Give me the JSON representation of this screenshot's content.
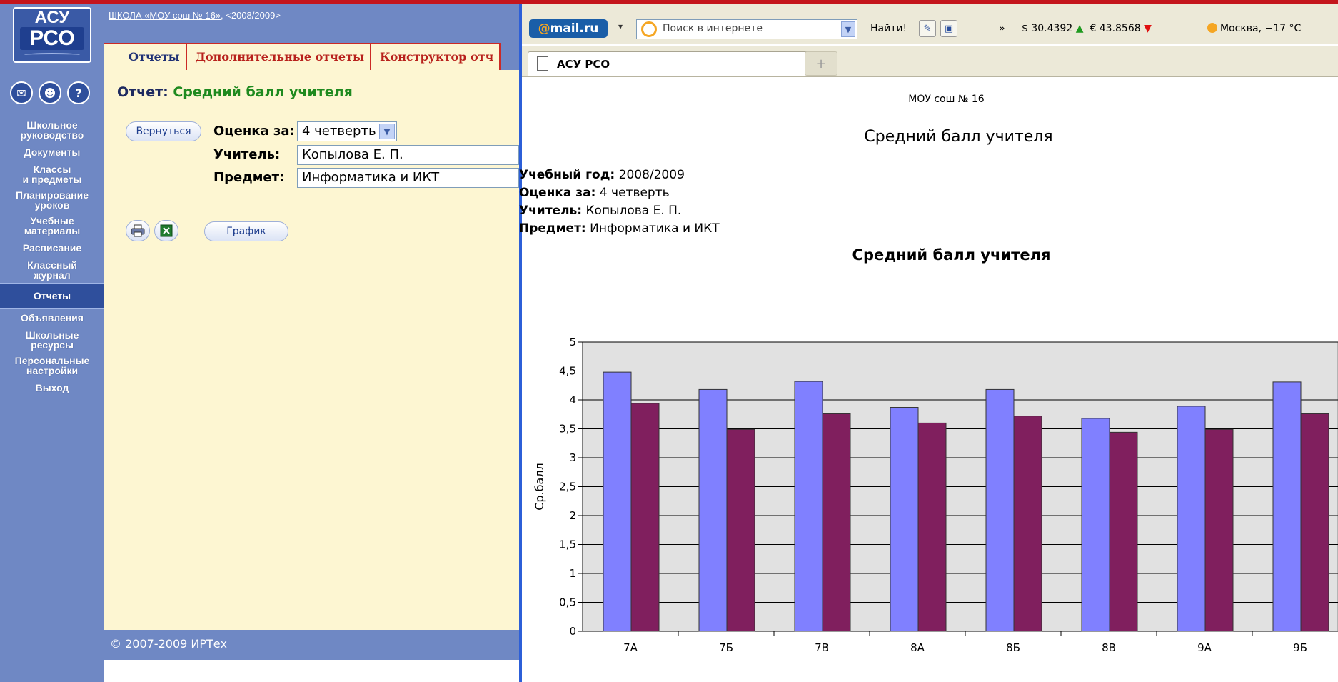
{
  "app": {
    "logo_top": "АСУ",
    "logo_bottom": "РСО",
    "header_school_link": "ШКОЛА «МОУ сош № 16»",
    "header_year": ", <2008/2009>",
    "nav": [
      {
        "label": "Школьное\nруководство"
      },
      {
        "label": "Документы"
      },
      {
        "label": "Классы\nи предметы"
      },
      {
        "label": "Планирование\nуроков"
      },
      {
        "label": "Учебные\nматериалы"
      },
      {
        "label": "Расписание"
      },
      {
        "label": "Классный\nжурнал"
      },
      {
        "label": "Отчеты"
      },
      {
        "label": "Объявления"
      },
      {
        "label": "Школьные\nресурсы"
      },
      {
        "label": "Персональные\nнастройки"
      },
      {
        "label": "Выход"
      }
    ],
    "tabs": [
      "Отчеты",
      "Дополнительные отчеты",
      "Конструктор отч"
    ],
    "report_label": "Отчет:",
    "report_name": "Средний балл учителя",
    "back_button": "Вернуться",
    "grade_label": "Оценка за:",
    "grade_value": "4 четверть",
    "teacher_label": "Учитель:",
    "teacher_value": "Копылова Е. П.",
    "subject_label": "Предмет:",
    "subject_value": "Информатика и ИКТ",
    "chart_button": "График",
    "footer": "© 2007-2009 ИРТех"
  },
  "browser": {
    "brand": "mail.ru",
    "search_placeholder": "Поиск в интернете",
    "find_button": "Найти!",
    "more": "»",
    "usd": "$ 30.4392",
    "eur": "€ 43.8568",
    "weather": "Москва, −17 °C",
    "tab_title": "АСУ РСО",
    "new_tab": "+"
  },
  "document": {
    "school": "МОУ сош № 16",
    "title": "Средний балл учителя",
    "year_label": "Учебный год:",
    "year_value": "2008/2009",
    "grade_label": "Оценка за:",
    "grade_value": "4 четверть",
    "teacher_label": "Учитель:",
    "teacher_value": "Копылова Е. П.",
    "subject_label": "Предмет:",
    "subject_value": "Информатика и ИКТ"
  },
  "chart_data": {
    "type": "bar",
    "title": "Средний балл учителя",
    "ylabel": "Ср.балл",
    "xlabel": "",
    "ylim": [
      0,
      5
    ],
    "yticks": [
      "0",
      "0,5",
      "1",
      "1,5",
      "2",
      "2,5",
      "3",
      "3,5",
      "4",
      "4,5",
      "5"
    ],
    "grid": true,
    "categories": [
      "7А",
      "7Б",
      "7В",
      "8А",
      "8Б",
      "8В",
      "9А",
      "9Б"
    ],
    "series": [
      {
        "values": [
          4.48,
          4.18,
          4.32,
          3.87,
          4.18,
          3.68,
          3.89,
          4.31
        ],
        "color": "#8080ff"
      },
      {
        "values": [
          3.94,
          3.49,
          3.76,
          3.6,
          3.72,
          3.44,
          3.49,
          3.76
        ],
        "color": "#801f5e"
      }
    ]
  }
}
